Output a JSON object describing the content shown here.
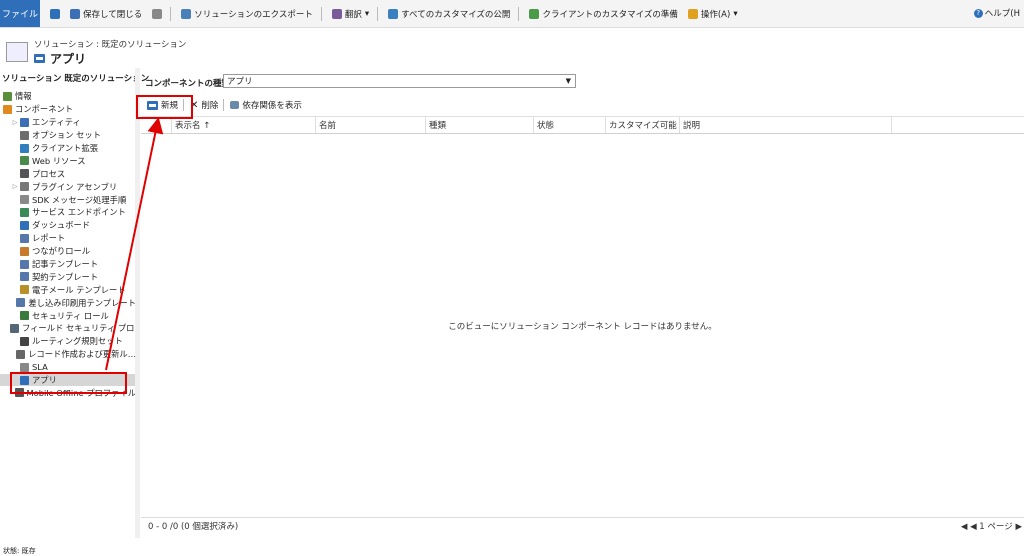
{
  "toolbar": {
    "file": "ファイル",
    "save_close": "保存して閉じる",
    "export": "ソリューションのエクスポート",
    "translate": "翻訳",
    "publish_all": "すべてのカスタマイズの公開",
    "prepare_client": "クライアントのカスタマイズの準備",
    "actions": "操作(A)",
    "help": "ヘルプ(H"
  },
  "header": {
    "breadcrumb": "ソリューション : 既定のソリューション",
    "title": "アプリ"
  },
  "sidebar": {
    "title": "ソリューション 既定のソリューション",
    "items": [
      {
        "label": "情報",
        "indent": 0,
        "tri": "",
        "color": "#5a8f3a"
      },
      {
        "label": "コンポーネント",
        "indent": 0,
        "tri": "",
        "color": "#e08a1e"
      },
      {
        "label": "エンティティ",
        "indent": 1,
        "tri": "▷",
        "color": "#3c6fb5"
      },
      {
        "label": "オプション セット",
        "indent": 1,
        "tri": "",
        "color": "#6d6d6d"
      },
      {
        "label": "クライアント拡張",
        "indent": 1,
        "tri": "",
        "color": "#2f7fbf"
      },
      {
        "label": "Web リソース",
        "indent": 1,
        "tri": "",
        "color": "#4a8a4a"
      },
      {
        "label": "プロセス",
        "indent": 1,
        "tri": "",
        "color": "#555555"
      },
      {
        "label": "プラグイン アセンブリ",
        "indent": 1,
        "tri": "▷",
        "color": "#777777"
      },
      {
        "label": "SDK メッセージ処理手順",
        "indent": 1,
        "tri": "",
        "color": "#8a8a8a"
      },
      {
        "label": "サービス エンドポイント",
        "indent": 1,
        "tri": "",
        "color": "#3a8a5a"
      },
      {
        "label": "ダッシュボード",
        "indent": 1,
        "tri": "",
        "color": "#2f6fba"
      },
      {
        "label": "レポート",
        "indent": 1,
        "tri": "",
        "color": "#5577aa"
      },
      {
        "label": "つながりロール",
        "indent": 1,
        "tri": "",
        "color": "#c77a2a"
      },
      {
        "label": "記事テンプレート",
        "indent": 1,
        "tri": "",
        "color": "#5577aa"
      },
      {
        "label": "契約テンプレート",
        "indent": 1,
        "tri": "",
        "color": "#5577aa"
      },
      {
        "label": "電子メール テンプレート",
        "indent": 1,
        "tri": "",
        "color": "#b8902a"
      },
      {
        "label": "差し込み印刷用テンプレート",
        "indent": 1,
        "tri": "",
        "color": "#5577aa"
      },
      {
        "label": "セキュリティ ロール",
        "indent": 1,
        "tri": "",
        "color": "#3a7a3a"
      },
      {
        "label": "フィールド セキュリティ プロ…",
        "indent": 1,
        "tri": "",
        "color": "#556677"
      },
      {
        "label": "ルーティング規則セット",
        "indent": 1,
        "tri": "",
        "color": "#444444"
      },
      {
        "label": "レコード作成および更新ル…",
        "indent": 1,
        "tri": "",
        "color": "#666666"
      },
      {
        "label": "SLA",
        "indent": 1,
        "tri": "",
        "color": "#888888"
      },
      {
        "label": "アプリ",
        "indent": 1,
        "tri": "",
        "color": "#2f6fba",
        "selected": true
      },
      {
        "label": "Mobile Offline プロファイル",
        "indent": 1,
        "tri": "",
        "color": "#555555"
      }
    ]
  },
  "main": {
    "component_type_label": "コンポーネントの種類",
    "component_type_value": "アプリ",
    "commands": {
      "new": "新規",
      "delete": "削除",
      "show_deps": "依存関係を表示"
    },
    "columns": [
      "表示名 ↑",
      "名前",
      "種類",
      "状態",
      "カスタマイズ可能",
      "説明"
    ],
    "empty_message": "このビューにソリューション コンポーネント レコードはありません。",
    "footer_left": "0 - 0 /0 (0 個選択済み)",
    "footer_right": "◀ ◀ 1 ページ ▶"
  },
  "bottom_text": "状態: 既存",
  "colors": {
    "accent": "#2f6fba",
    "highlight": "#e00000"
  }
}
